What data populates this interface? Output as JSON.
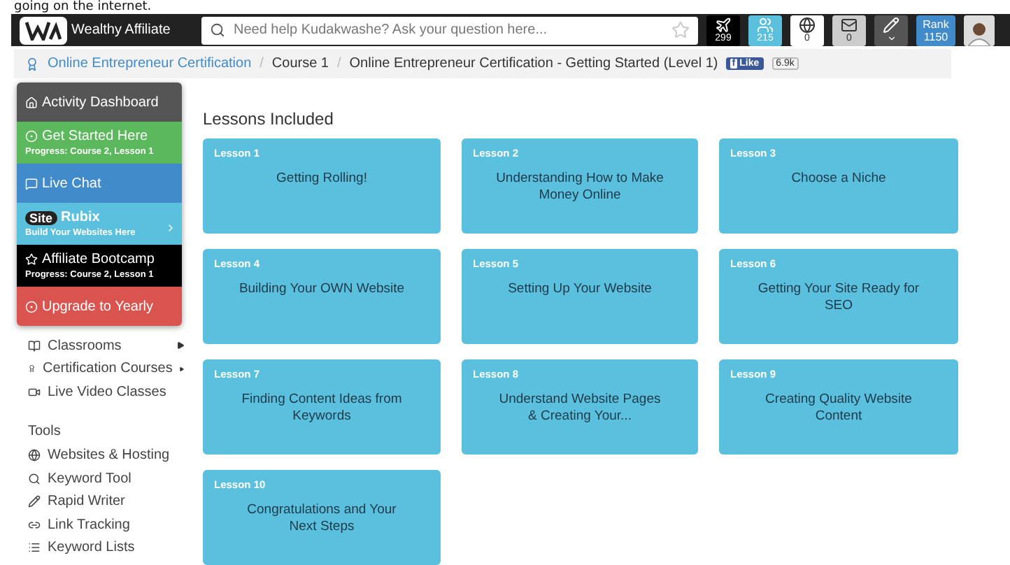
{
  "document_text": "going on the internet.",
  "header": {
    "logo_text": "Wealthy Affiliate",
    "search": {
      "placeholder": "Need help Kudakwashe? Ask your question here..."
    },
    "icons": [
      {
        "kind": "plane",
        "count": "299",
        "color": "#000000"
      },
      {
        "kind": "people",
        "count": "215",
        "color": "#5bc0de"
      },
      {
        "kind": "globe",
        "count": "0",
        "color": "#ffffff"
      },
      {
        "kind": "mail",
        "count": "0",
        "color": "#cccccc"
      },
      {
        "kind": "pen",
        "color": "#555555"
      }
    ],
    "rank": {
      "label": "Rank",
      "value": "1150"
    }
  },
  "breadcrumb": {
    "items": [
      "Online Entrepreneur Certification",
      "Course 1",
      "Online Entrepreneur Certification - Getting Started (Level 1)"
    ],
    "separator": "/",
    "facebook_mark": "f",
    "like": "Like",
    "like_count": "6.9k"
  },
  "menu": [
    {
      "kind": "plain",
      "title": "Activity Dashboard",
      "color": "#555555"
    },
    {
      "kind": "progress",
      "title": "Get Started Here",
      "subtitle": "Progress: Course 2, Lesson 1",
      "color": "#5cb85c"
    },
    {
      "kind": "plain",
      "title": "Live Chat",
      "color": "#428bca"
    },
    {
      "kind": "brand",
      "badge": "Site",
      "title": "Rubix",
      "subtitle": "Build Your Websites Here",
      "color": "#5bc0de"
    },
    {
      "kind": "progress",
      "title": "Affiliate Bootcamp",
      "subtitle": "Progress: Course 2, Lesson 1",
      "color": "#000000"
    },
    {
      "kind": "plain",
      "title": "Upgrade to Yearly",
      "color": "#d9534f"
    }
  ],
  "sidebar": {
    "items": [
      {
        "label": "Classrooms",
        "submenu": true
      },
      {
        "label": "Certification Courses",
        "submenu": true
      },
      {
        "label": "Live Video Classes",
        "submenu": false
      }
    ],
    "tools_heading": "Tools",
    "tools": [
      {
        "label": "Websites & Hosting"
      },
      {
        "label": "Keyword Tool"
      },
      {
        "label": "Rapid Writer"
      },
      {
        "label": "Link Tracking"
      },
      {
        "label": "Keyword Lists"
      }
    ]
  },
  "lessons_heading": "Lessons Included",
  "lessons": [
    {
      "number": "Lesson 1",
      "title": "Getting Rolling!"
    },
    {
      "number": "Lesson 2",
      "title": "Understanding How to Make Money Online"
    },
    {
      "number": "Lesson 3",
      "title": "Choose a Niche"
    },
    {
      "number": "Lesson 4",
      "title": "Building Your OWN Website"
    },
    {
      "number": "Lesson 5",
      "title": "Setting Up Your Website"
    },
    {
      "number": "Lesson 6",
      "title": "Getting Your Site Ready for SEO"
    },
    {
      "number": "Lesson 7",
      "title": "Finding Content Ideas from Keywords"
    },
    {
      "number": "Lesson 8",
      "title": "Understand Website Pages & Creating Your..."
    },
    {
      "number": "Lesson 9",
      "title": "Creating Quality Website Content"
    },
    {
      "number": "Lesson 10",
      "title": "Congratulations and Your Next Steps"
    }
  ]
}
